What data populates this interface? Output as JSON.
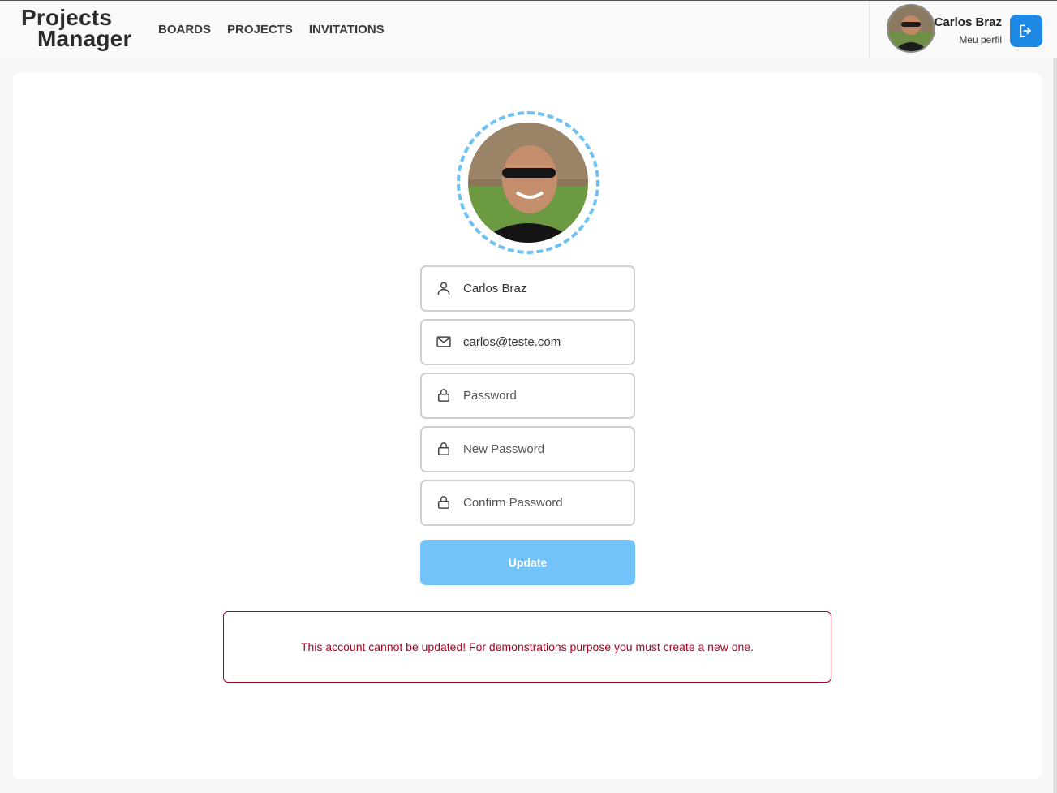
{
  "app": {
    "logo_line1": "Projects",
    "logo_line2": "Manager"
  },
  "nav": {
    "items": [
      {
        "label": "BOARDS"
      },
      {
        "label": "PROJECTS"
      },
      {
        "label": "INVITATIONS"
      }
    ]
  },
  "user": {
    "name": "Carlos Braz",
    "profile_link": "Meu perfil"
  },
  "form": {
    "name_value": "Carlos Braz",
    "email_value": "carlos@teste.com",
    "password_placeholder": "Password",
    "new_password_placeholder": "New Password",
    "confirm_password_placeholder": "Confirm Password",
    "update_label": "Update"
  },
  "alert": {
    "message": "This account cannot be updated! For demonstrations purpose you must create a new one."
  },
  "icons": {
    "name": "user-icon",
    "email": "mail-icon",
    "password": "lock-icon",
    "logout": "logout-icon"
  },
  "colors": {
    "accent": "#1e88e5",
    "update_button": "#73c3fb",
    "avatar_ring": "#6ec1f2",
    "error": "#b00020"
  }
}
